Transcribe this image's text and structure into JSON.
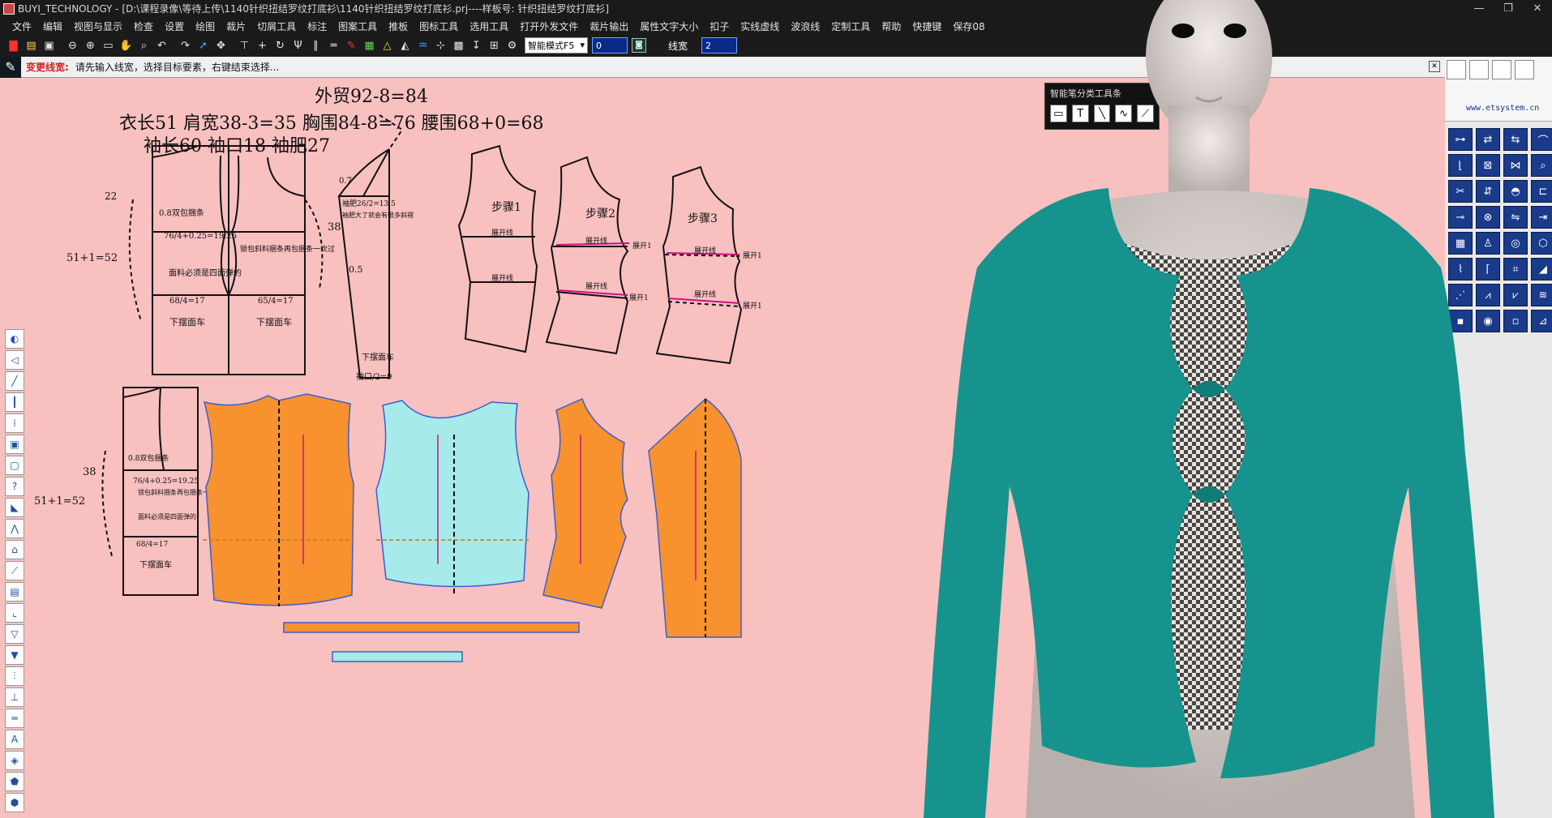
{
  "window": {
    "title": "BUYI_TECHNOLOGY - [D:\\课程录像\\等待上传\\1140针织扭结罗纹打底衫\\1140针织扭结罗纹打底衫.prj----样板号: 针织扭结罗纹打底衫]",
    "controls": [
      "—",
      "❐",
      "✕"
    ]
  },
  "menu": [
    "文件",
    "编辑",
    "视图与显示",
    "检查",
    "设置",
    "绘图",
    "裁片",
    "切屑工具",
    "标注",
    "图案工具",
    "推板",
    "图标工具",
    "选用工具",
    "打开外发文件",
    "裁片输出",
    "属性文字大小",
    "扣子",
    "实线虚线",
    "波浪线",
    "定制工具",
    "帮助",
    "快捷键",
    "保存08"
  ],
  "toolbar": {
    "mode": "智能模式F5",
    "value_field": "0",
    "line_width_label": "线宽",
    "line_width_value": "2"
  },
  "status": {
    "command": "变更线宽:",
    "message": "请先输入线宽，选择目标要素，右键结束选择..."
  },
  "smart_toolbar": {
    "title": "智能笔分类工具条",
    "tools": [
      "▭",
      "T",
      "╲",
      "∿",
      "⟋"
    ]
  },
  "right_panel": {
    "brand": "www.etsystem.cn"
  },
  "drawing": {
    "heading": "外贸92-8=84",
    "measurements_1": "衣长51  肩宽38-3=35  胸围84-8=76  腰围68+0=68",
    "measurements_2": "袖长60 袖口18  袖肥27",
    "label_side": "51+1=52",
    "label_38": "38",
    "label_22": "22",
    "label_5152": "51+1=52",
    "label_38b": "38",
    "note_double": "0.8双包捆条",
    "note_chest": "76/4+0.25=19.25",
    "note_fabric": "面料必须是四面弹的",
    "note_hem": "下摆面车",
    "note_waist": "68/4=17",
    "note_waist2": "65/4=17",
    "note_bind": "锁包斜料捆条再包捆条一次过",
    "note_sleeve": "袖肥26/2=13.5",
    "note_sleeve2": "袖肥大了就会有很多斜褶",
    "note_cuff": "袖口/2=9",
    "note_05": "0.5",
    "note_07": "0.7",
    "step1": "步骤1",
    "step2": "步骤2",
    "step3": "步骤3",
    "open_line": "展开线",
    "open_1": "展开1"
  }
}
